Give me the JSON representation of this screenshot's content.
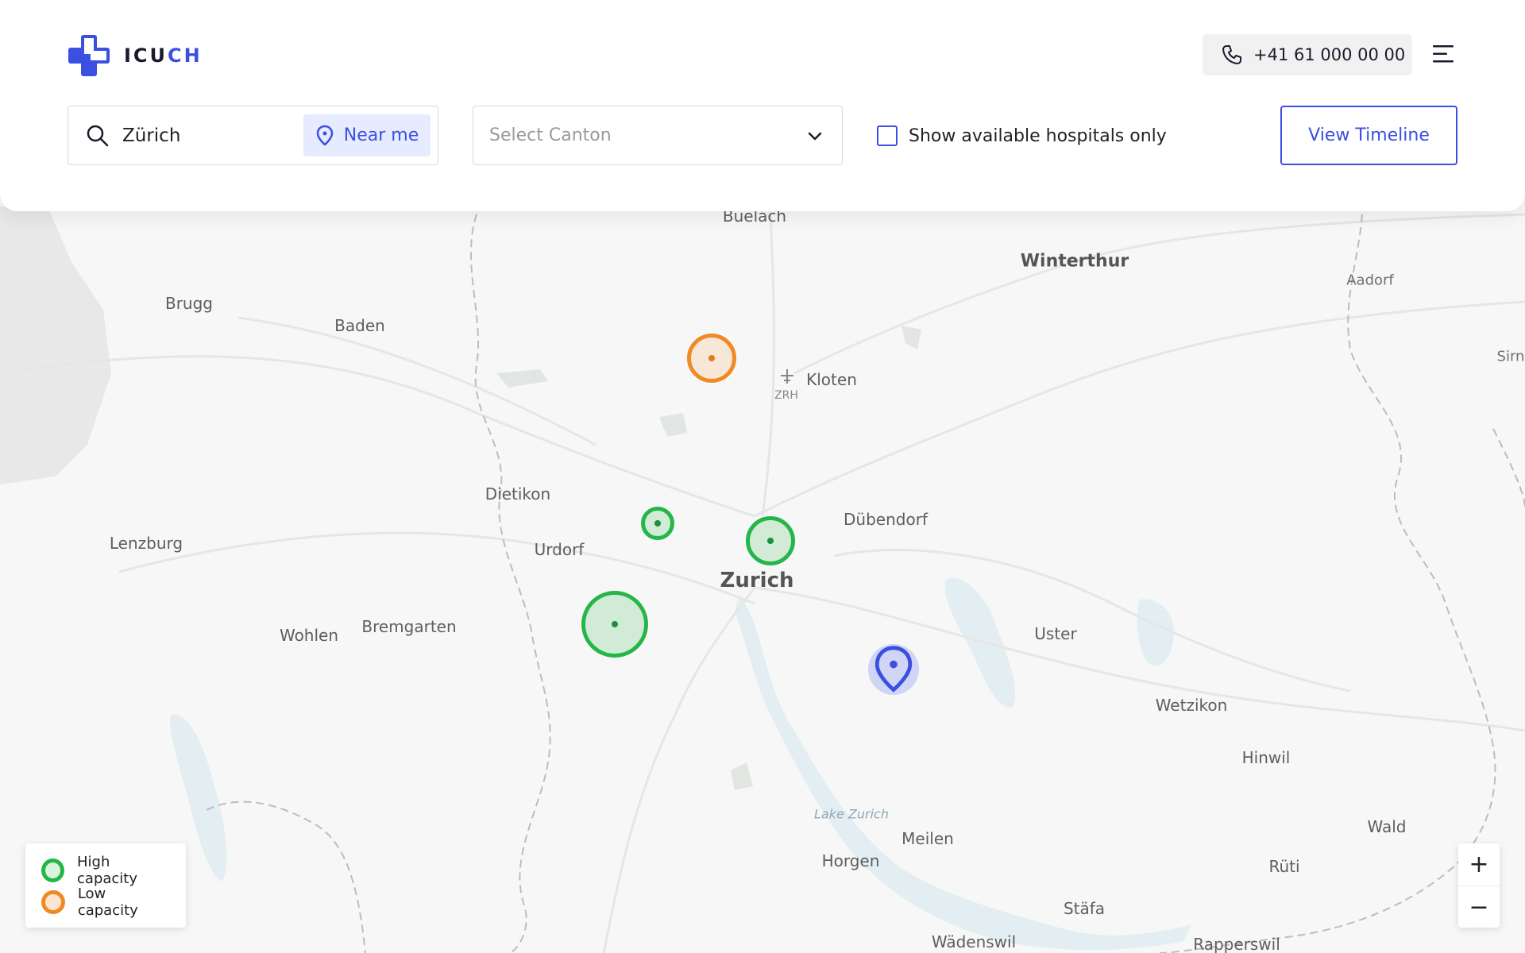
{
  "app": {
    "logo_text_main": "ICU",
    "logo_text_accent": "CH",
    "phone": "+41 61 000 00 00"
  },
  "search": {
    "value": "Zürich",
    "placeholder": "Search",
    "near_me_label": "Near me"
  },
  "canton_select": {
    "placeholder": "Select Canton"
  },
  "filters": {
    "available_only_label": "Show available hospitals only",
    "available_only_checked": false
  },
  "actions": {
    "view_timeline_label": "View Timeline"
  },
  "map": {
    "places": [
      {
        "name": "Buelach",
        "size": "md"
      },
      {
        "name": "Winterthur",
        "size": "lg"
      },
      {
        "name": "Aadorf",
        "size": "sm"
      },
      {
        "name": "Sirn",
        "size": "sm"
      },
      {
        "name": "Brugg",
        "size": "md"
      },
      {
        "name": "Baden",
        "size": "md"
      },
      {
        "name": "Kloten",
        "size": "md"
      },
      {
        "name": "ZRH",
        "size": "code"
      },
      {
        "name": "Dietikon",
        "size": "md"
      },
      {
        "name": "Dübendorf",
        "size": "md"
      },
      {
        "name": "Lenzburg",
        "size": "md"
      },
      {
        "name": "Urdorf",
        "size": "md"
      },
      {
        "name": "Zurich",
        "size": "xl"
      },
      {
        "name": "Wohlen",
        "size": "md"
      },
      {
        "name": "Bremgarten",
        "size": "md"
      },
      {
        "name": "Uster",
        "size": "md"
      },
      {
        "name": "Wetzikon",
        "size": "md"
      },
      {
        "name": "Hinwil",
        "size": "md"
      },
      {
        "name": "Lake Zurich",
        "size": "water"
      },
      {
        "name": "Meilen",
        "size": "md"
      },
      {
        "name": "Horgen",
        "size": "md"
      },
      {
        "name": "Wald",
        "size": "md"
      },
      {
        "name": "Rüti",
        "size": "md"
      },
      {
        "name": "Stäfa",
        "size": "md"
      },
      {
        "name": "Wädenswil",
        "size": "md"
      },
      {
        "name": "Rapperswil",
        "size": "md"
      }
    ],
    "hospitals": [
      {
        "capacity": "low"
      },
      {
        "capacity": "high"
      },
      {
        "capacity": "high"
      },
      {
        "capacity": "high"
      }
    ]
  },
  "legend": {
    "high_label": "High capacity",
    "low_label": "Low capacity"
  },
  "zoom": {
    "in_label": "+",
    "out_label": "−"
  },
  "colors": {
    "accent": "#3b4fe0",
    "high": "#25b64a",
    "low": "#f08a24"
  }
}
